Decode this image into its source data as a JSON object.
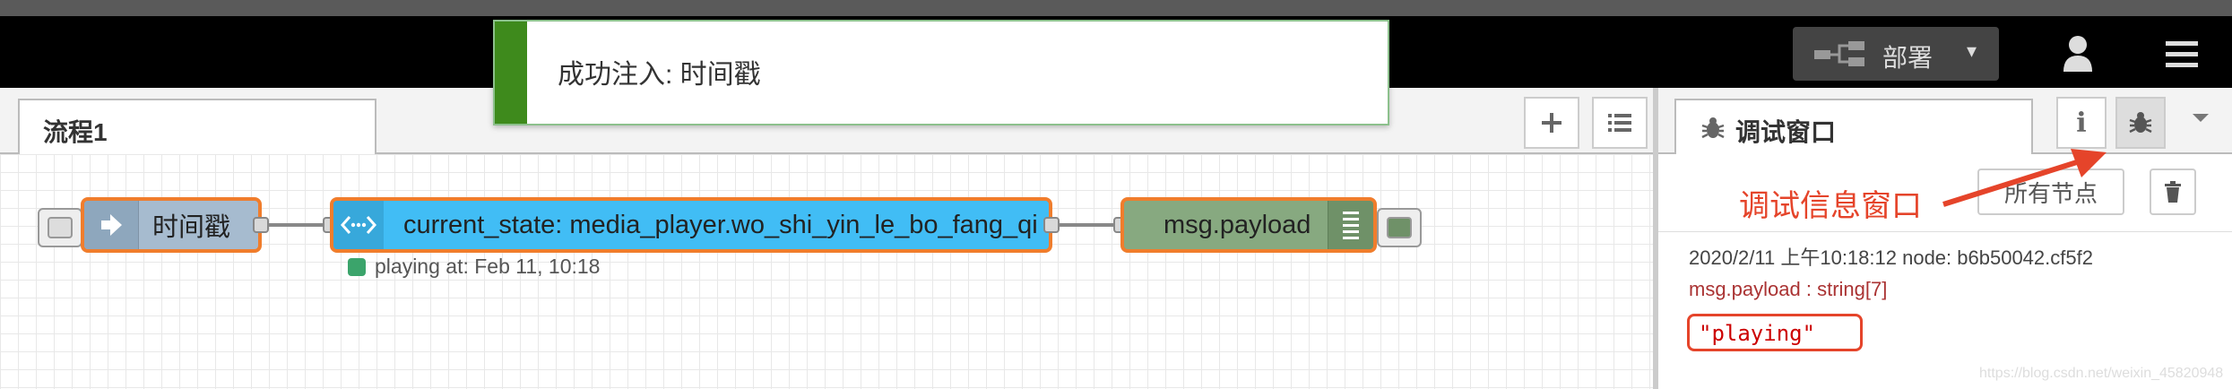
{
  "header": {
    "deploy_label": "部署",
    "deploy_caret": "▾"
  },
  "notification": {
    "message": "成功注入: 时间戳"
  },
  "workspace": {
    "tab_label": "流程1",
    "add_icon": "plus-icon",
    "list_icon": "list-icon"
  },
  "nodes": {
    "inject": {
      "label": "时间戳"
    },
    "ha": {
      "label": "current_state: media_player.wo_shi_yin_le_bo_fang_qi",
      "status": "playing at: Feb 11, 10:18"
    },
    "debug": {
      "label": "msg.payload"
    }
  },
  "sidebar": {
    "tab_label": "调试窗口",
    "info_glyph": "i",
    "filter_label": "所有节点",
    "annotation": "调试信息窗口",
    "message": {
      "meta": "2020/2/11 上午10:18:12   node: b6b50042.cf5f2",
      "topic": "msg.payload : string[7]",
      "value": "\"playing\""
    }
  },
  "watermark": "https://blog.csdn.net/weixin_45820948",
  "colors": {
    "header": "#000000",
    "notification_accent": "#3e8a1c",
    "inject_node": "#a6bbcf",
    "ha_node": "#41bdf5",
    "debug_node": "#87a980",
    "selected_border": "#f07d2c",
    "annotation": "#e5442a"
  }
}
